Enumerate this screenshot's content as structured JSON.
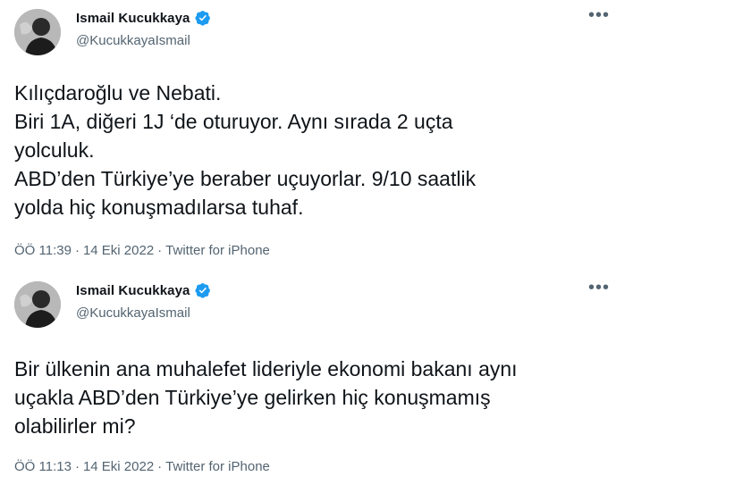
{
  "tweets": [
    {
      "author": {
        "display_name": "Ismail Kucukkaya",
        "handle": "@KucukkayaIsmail",
        "verified": true
      },
      "more_icon": "•••",
      "lines": [
        "Kılıçdaroğlu ve Nebati.",
        "Biri 1A, diğeri 1J ‘de oturuyor. Aynı sırada 2 uçta",
        "yolculuk.",
        "ABD’den Türkiye’ye beraber uçuyorlar. 9/10 saatlik",
        "yolda hiç konuşmadılarsa tuhaf."
      ],
      "time": "ÖÖ 11:39",
      "date": "14 Eki 2022",
      "source": "Twitter for iPhone"
    },
    {
      "author": {
        "display_name": "Ismail Kucukkaya",
        "handle": "@KucukkayaIsmail",
        "verified": true
      },
      "more_icon": "•••",
      "lines": [
        "Bir ülkenin ana muhalefet lideriyle ekonomi bakanı aynı",
        "uçakla ABD’den Türkiye’ye gelirken hiç konuşmamış",
        "olabilirler mi?"
      ],
      "time": "ÖÖ 11:13",
      "date": "14 Eki 2022",
      "source": "Twitter for iPhone"
    }
  ],
  "meta_separator": "·",
  "colors": {
    "text_primary": "#0f1419",
    "text_secondary": "#536471",
    "verified_blue": "#1d9bf0",
    "background": "#ffffff"
  },
  "icons": {
    "verified": "verified-badge-icon",
    "more": "more-options-icon"
  }
}
